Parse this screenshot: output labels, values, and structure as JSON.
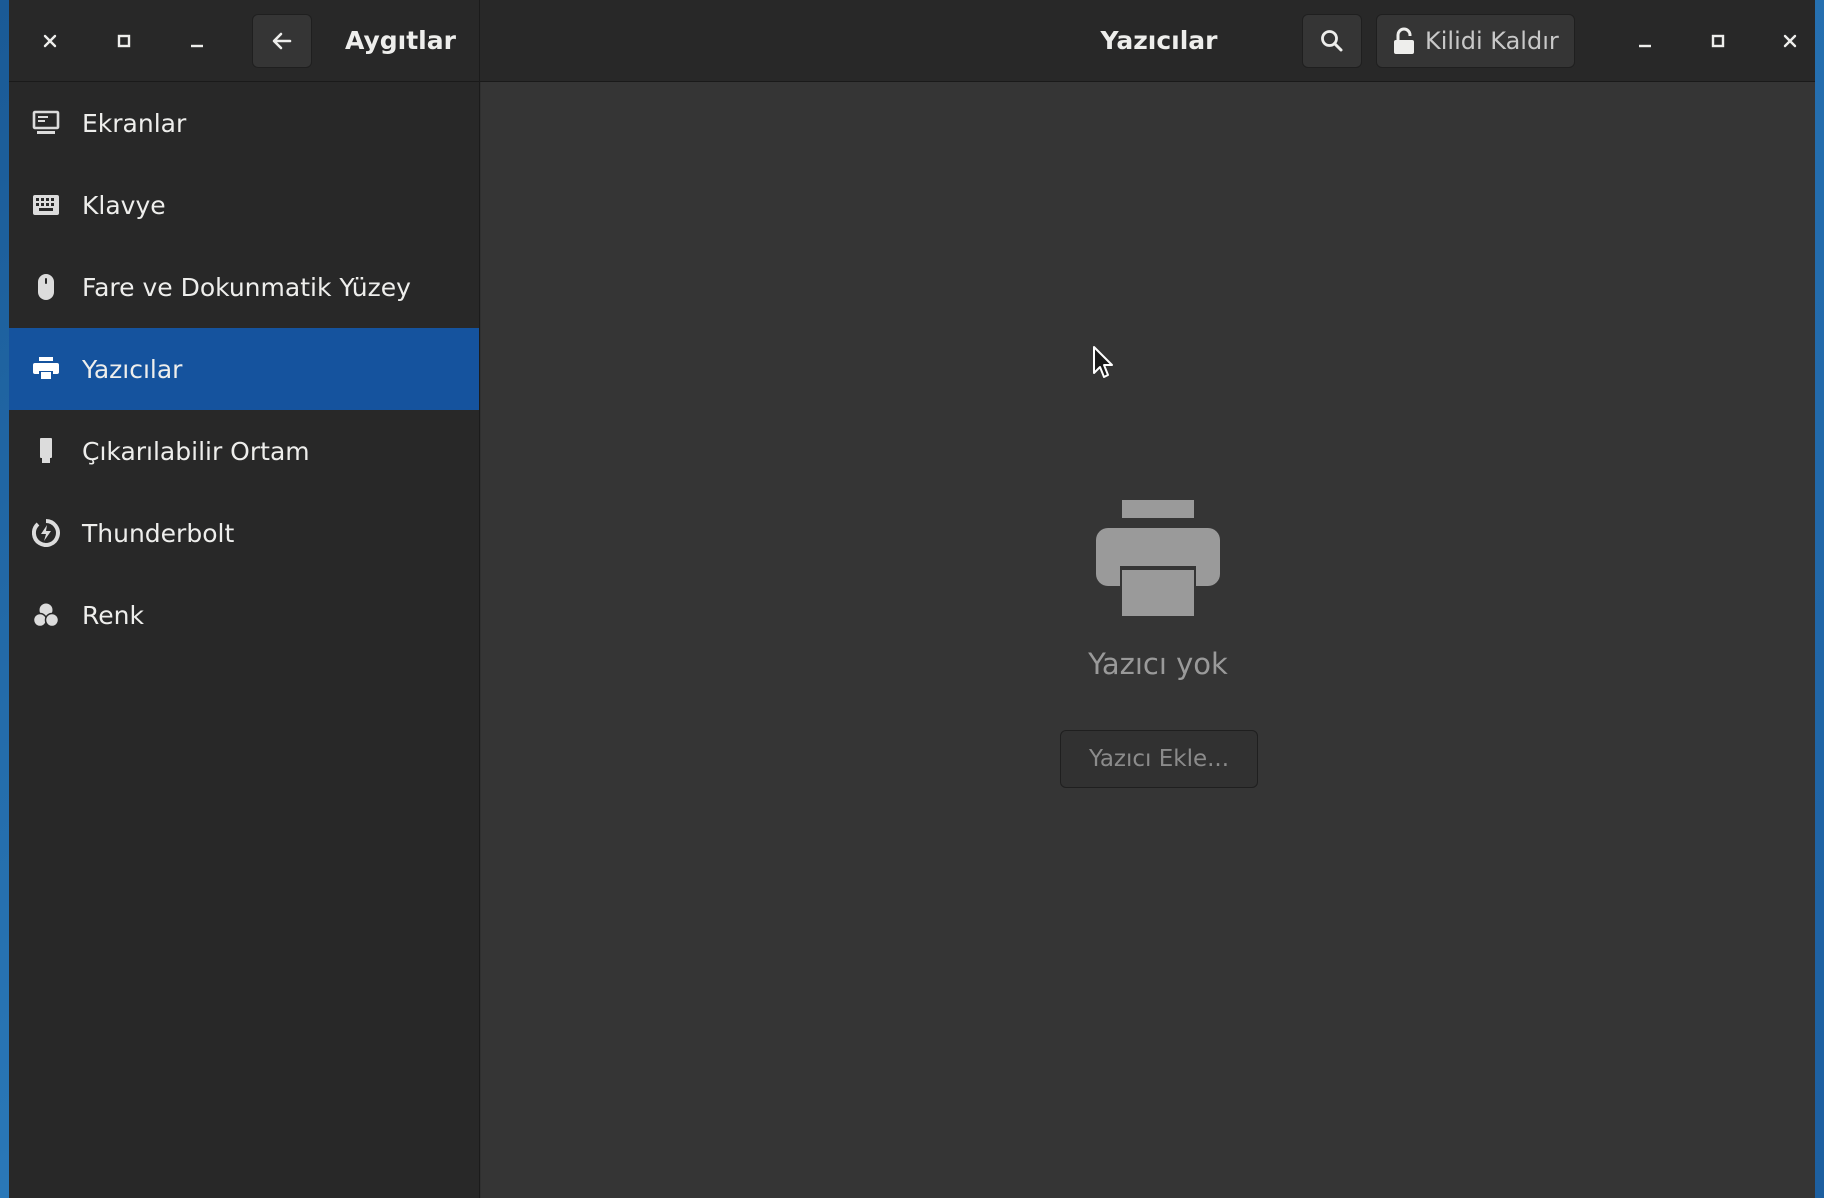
{
  "header": {
    "left_title": "Aygıtlar",
    "center_title": "Yazıcılar",
    "unlock_label": "Kilidi Kaldır"
  },
  "sidebar": {
    "items": [
      {
        "label": "Ekranlar",
        "icon": "display-icon",
        "active": false
      },
      {
        "label": "Klavye",
        "icon": "keyboard-icon",
        "active": false
      },
      {
        "label": "Fare ve Dokunmatik Yüzey",
        "icon": "mouse-icon",
        "active": false
      },
      {
        "label": "Yazıcılar",
        "icon": "printer-icon",
        "active": true
      },
      {
        "label": "Çıkarılabilir Ortam",
        "icon": "usb-drive-icon",
        "active": false
      },
      {
        "label": "Thunderbolt",
        "icon": "thunderbolt-icon",
        "active": false
      },
      {
        "label": "Renk",
        "icon": "color-icon",
        "active": false
      }
    ]
  },
  "main": {
    "empty_text": "Yazıcı yok",
    "add_button_label": "Yazıcı Ekle..."
  },
  "colors": {
    "accent": "#15539e",
    "sidebar_bg": "#282828",
    "main_bg": "#353535"
  }
}
